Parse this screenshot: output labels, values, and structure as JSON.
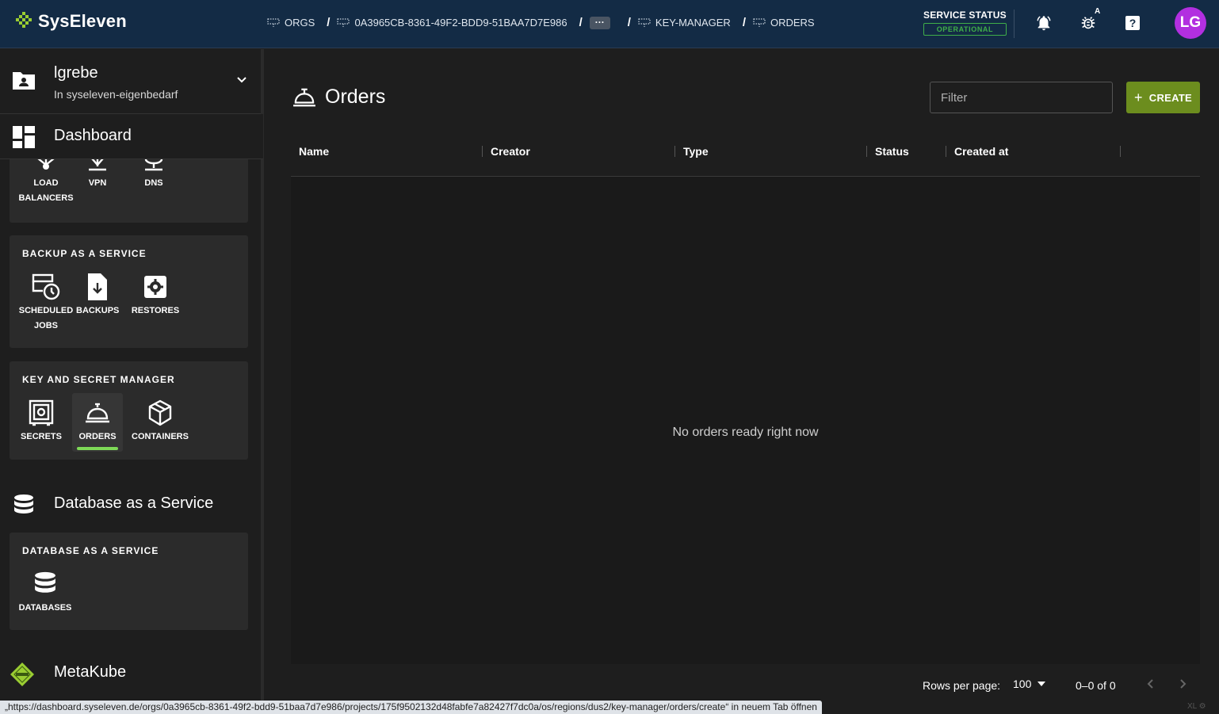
{
  "brand": {
    "name": "SysEleven",
    "icon": "syseleven-logo-icon"
  },
  "breadcrumbs": [
    {
      "label": "ORGS",
      "icon": "org-icon"
    },
    {
      "label": "0A3965CB-8361-49F2-BDD9-51BAA7D7E986",
      "icon": "org-icon"
    },
    {
      "label": "···",
      "icon": ""
    },
    {
      "label": "KEY-MANAGER",
      "icon": "org-icon"
    },
    {
      "label": "ORDERS",
      "icon": "org-icon"
    }
  ],
  "service_status": {
    "title": "SERVICE STATUS",
    "badge": "OPERATIONAL",
    "color": "#3fae49"
  },
  "header_icons": [
    "notifications-icon",
    "bug-report-icon",
    "help-icon"
  ],
  "bug_badge": "A",
  "user": {
    "initials": "LG",
    "color": "#b22fe0"
  },
  "sidebar": {
    "project": {
      "name": "lgrebe",
      "org": "In syseleven-eigenbedarf"
    },
    "dashboard_label": "Dashboard",
    "network_tiles": [
      "LOAD BALANCERS",
      "VPN",
      "DNS"
    ],
    "network_tile_lines": {
      "lb_1": "LOAD",
      "lb_2": "BALANCERS"
    },
    "backup": {
      "title": "BACKUP AS A SERVICE",
      "tiles": {
        "scheduled_1": "SCHEDULED",
        "scheduled_2": "JOBS",
        "backups": "BACKUPS",
        "restores": "RESTORES"
      }
    },
    "keymanager": {
      "title": "KEY AND SECRET MANAGER",
      "tiles": {
        "secrets": "SECRETS",
        "orders": "ORDERS",
        "containers": "CONTAINERS"
      },
      "active": "ORDERS"
    },
    "dbaas_section": "Database as a Service",
    "dbaas": {
      "title": "DATABASE AS A SERVICE",
      "tiles": {
        "databases": "DATABASES"
      }
    },
    "metakube_section": "MetaKube"
  },
  "main": {
    "title": "Orders",
    "filter_placeholder": "Filter",
    "create_label": "CREATE",
    "columns": [
      "Name",
      "Creator",
      "Type",
      "Status",
      "Created at"
    ],
    "empty_message": "No orders ready right now",
    "footer": {
      "rows_label": "Rows per page:",
      "rows_value": "100",
      "range": "0–0 of 0"
    }
  },
  "accent_color": "#7ed957",
  "create_color": "#6c8d1e",
  "statusbar": {
    "url": "„https://dashboard.syseleven.de/orgs/0a3965cb-8361-49f2-bdd9-51baa7d7e986/projects/175f9502132d48fabfe7a82427f7dc0a/os/regions/dus2/key-manager/orders/create“ in neuem Tab öffnen",
    "corner": "XL"
  }
}
